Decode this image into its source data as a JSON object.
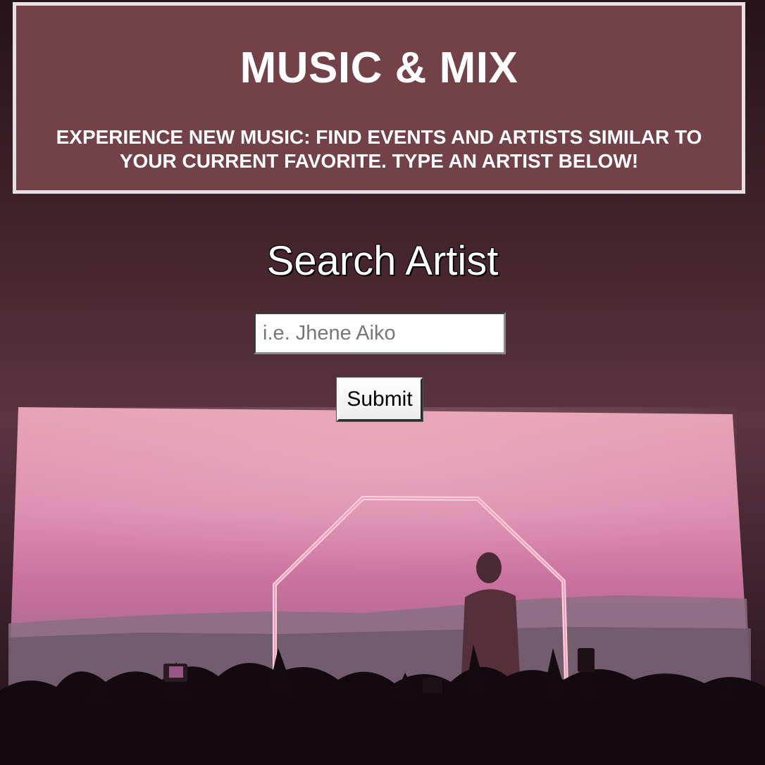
{
  "header": {
    "title": "MUSIC & MIX",
    "tagline": "EXPERIENCE NEW MUSIC: FIND EVENTS AND ARTISTS SIMILAR TO YOUR CURRENT FAVORITE. TYPE AN ARTIST BELOW!"
  },
  "search": {
    "heading": "Search Artist",
    "placeholder": "i.e. Jhene Aiko",
    "value": "",
    "submit_label": "Submit"
  },
  "colors": {
    "header_bg": "#734249",
    "header_border": "#e8dfe2",
    "screen_top": "#e9a0b8",
    "screen_bottom": "#a0516f"
  },
  "background_image": "concert-stage-photo"
}
